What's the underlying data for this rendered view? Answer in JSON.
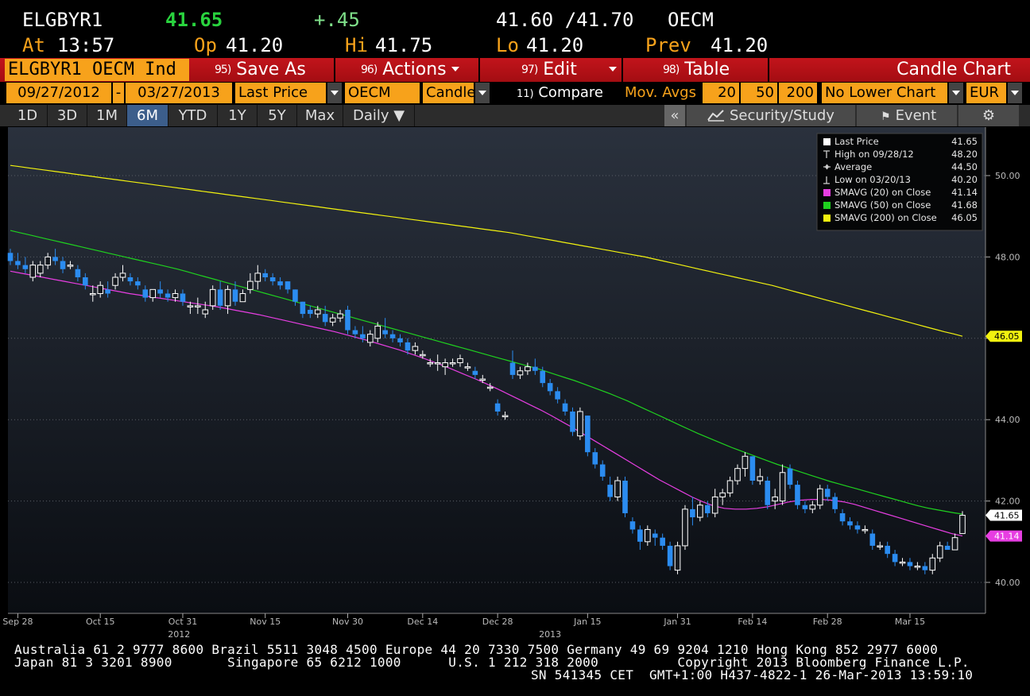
{
  "header": {
    "ticker": "ELGBYR1",
    "last": "41.65",
    "change": "+.45",
    "bid_ask": "41.60 /41.70",
    "source": "OECM",
    "at_label": "At",
    "at_time": "13:57",
    "open_label": "Op",
    "open": "41.20",
    "high_label": "Hi",
    "high": "41.75",
    "low_label": "Lo",
    "low": "41.20",
    "prev_label": "Prev",
    "prev": "41.20"
  },
  "toolbar": {
    "security": "ELGBYR1 OECM Ind",
    "save_num": "95)",
    "save_label": "Save As",
    "actions_num": "96)",
    "actions_label": "Actions",
    "edit_num": "97)",
    "edit_label": "Edit",
    "table_num": "98)",
    "table_label": "Table",
    "chart_type_title": "Candle Chart"
  },
  "options": {
    "start_date": "09/27/2012",
    "dash": "-",
    "end_date": "03/27/2013",
    "field": "Last Price",
    "source": "OECM",
    "style": "Candle",
    "compare_num": "11)",
    "compare": "Compare",
    "mov_avgs": "Mov. Avgs",
    "ma1": "20",
    "ma2": "50",
    "ma3": "200",
    "lower_chart": "No Lower Chart",
    "currency": "EUR"
  },
  "ranges": {
    "items": [
      "1D",
      "3D",
      "1M",
      "6M",
      "YTD",
      "1Y",
      "5Y",
      "Max"
    ],
    "selected": "6M",
    "frequency": "Daily",
    "collapse": "«",
    "security_study": "Security/Study",
    "event": "Event"
  },
  "chart_data": {
    "type": "candlestick",
    "y_ticks": [
      "50.00",
      "48.00",
      "46.00",
      "44.00",
      "42.00",
      "40.00"
    ],
    "ylim": [
      39.5,
      51.2
    ],
    "x_ticks": [
      "Sep 28",
      "Oct 15",
      "Oct 31",
      "Nov 15",
      "Nov 30",
      "Dec 14",
      "Dec 28",
      "Jan 15",
      "Jan 31",
      "Feb 14",
      "Feb 28",
      "Mar 15"
    ],
    "year_labels": [
      "2012",
      "2013"
    ],
    "legend": [
      {
        "icon": "box",
        "label": "Last Price",
        "value": "41.65"
      },
      {
        "icon": "high",
        "label": "High on 09/28/12",
        "value": "48.20"
      },
      {
        "icon": "avg",
        "label": "Average",
        "value": "44.50"
      },
      {
        "icon": "low",
        "label": "Low on 03/20/13",
        "value": "40.20"
      },
      {
        "icon": "#e73ee2",
        "label": "SMAVG (20) on Close",
        "value": "41.14"
      },
      {
        "icon": "#1fd11f",
        "label": "SMAVG (50) on Close",
        "value": "41.68"
      },
      {
        "icon": "#f2f20f",
        "label": "SMAVG (200) on Close",
        "value": "46.05"
      }
    ],
    "price_tags": [
      {
        "value": "46.05",
        "color": "#f2f20f"
      },
      {
        "value": "41.65",
        "color": "#ffffff"
      },
      {
        "value": "41.14",
        "color": "#e73ee2"
      }
    ],
    "candles": [
      [
        48.1,
        48.2,
        47.8,
        47.9
      ],
      [
        47.9,
        48.1,
        47.7,
        47.8
      ],
      [
        47.8,
        48.0,
        47.6,
        47.7
      ],
      [
        47.5,
        47.9,
        47.4,
        47.8
      ],
      [
        47.6,
        47.9,
        47.5,
        47.8
      ],
      [
        47.8,
        48.1,
        47.7,
        48.0
      ],
      [
        48.0,
        48.2,
        47.8,
        47.9
      ],
      [
        47.9,
        48.0,
        47.6,
        47.7
      ],
      [
        47.8,
        47.9,
        47.7,
        47.8
      ],
      [
        47.7,
        47.8,
        47.4,
        47.5
      ],
      [
        47.5,
        47.6,
        47.2,
        47.3
      ],
      [
        47.1,
        47.3,
        46.9,
        47.1
      ],
      [
        47.1,
        47.4,
        47.0,
        47.3
      ],
      [
        47.2,
        47.4,
        47.0,
        47.1
      ],
      [
        47.3,
        47.6,
        47.2,
        47.5
      ],
      [
        47.5,
        47.8,
        47.4,
        47.6
      ],
      [
        47.5,
        47.6,
        47.3,
        47.4
      ],
      [
        47.4,
        47.5,
        47.2,
        47.3
      ],
      [
        47.2,
        47.3,
        46.9,
        47.0
      ],
      [
        47.0,
        47.2,
        46.9,
        47.2
      ],
      [
        47.2,
        47.4,
        47.0,
        47.1
      ],
      [
        47.1,
        47.2,
        46.9,
        47.0
      ],
      [
        47.0,
        47.2,
        46.9,
        47.1
      ],
      [
        47.1,
        47.2,
        46.8,
        46.9
      ],
      [
        46.8,
        46.9,
        46.6,
        46.8
      ],
      [
        46.8,
        47.0,
        46.6,
        46.8
      ],
      [
        46.6,
        46.9,
        46.5,
        46.7
      ],
      [
        46.8,
        47.3,
        46.7,
        47.2
      ],
      [
        47.2,
        47.4,
        46.7,
        46.8
      ],
      [
        46.8,
        47.3,
        46.6,
        47.2
      ],
      [
        47.2,
        47.4,
        46.8,
        46.9
      ],
      [
        46.9,
        47.2,
        46.9,
        47.1
      ],
      [
        47.2,
        47.6,
        47.1,
        47.4
      ],
      [
        47.4,
        47.8,
        47.2,
        47.6
      ],
      [
        47.6,
        47.7,
        47.4,
        47.5
      ],
      [
        47.5,
        47.6,
        47.3,
        47.4
      ],
      [
        47.4,
        47.5,
        47.2,
        47.3
      ],
      [
        47.4,
        47.4,
        47.1,
        47.2
      ],
      [
        47.2,
        47.2,
        46.8,
        46.9
      ],
      [
        46.9,
        46.9,
        46.5,
        46.6
      ],
      [
        46.7,
        46.8,
        46.5,
        46.6
      ],
      [
        46.6,
        46.8,
        46.5,
        46.7
      ],
      [
        46.6,
        46.8,
        46.3,
        46.4
      ],
      [
        46.4,
        46.6,
        46.3,
        46.5
      ],
      [
        46.5,
        46.7,
        46.4,
        46.6
      ],
      [
        46.7,
        46.8,
        46.1,
        46.2
      ],
      [
        46.2,
        46.3,
        46.0,
        46.1
      ],
      [
        46.1,
        46.3,
        45.9,
        46.0
      ],
      [
        45.9,
        46.2,
        45.8,
        46.1
      ],
      [
        46.0,
        46.4,
        45.9,
        46.3
      ],
      [
        46.2,
        46.5,
        46.0,
        46.1
      ],
      [
        46.1,
        46.2,
        45.9,
        46.0
      ],
      [
        46.0,
        46.1,
        45.8,
        45.9
      ],
      [
        45.9,
        46.0,
        45.6,
        45.7
      ],
      [
        45.7,
        45.9,
        45.6,
        45.8
      ],
      [
        45.6,
        45.7,
        45.5,
        45.6
      ],
      [
        45.4,
        45.5,
        45.3,
        45.4
      ],
      [
        45.4,
        45.6,
        45.2,
        45.4
      ],
      [
        45.3,
        45.5,
        45.1,
        45.4
      ],
      [
        45.4,
        45.5,
        45.3,
        45.4
      ],
      [
        45.4,
        45.6,
        45.3,
        45.5
      ],
      [
        45.3,
        45.4,
        45.2,
        45.3
      ],
      [
        45.2,
        45.3,
        45.0,
        45.1
      ],
      [
        45.0,
        45.1,
        44.9,
        45.0
      ],
      [
        44.8,
        44.9,
        44.7,
        44.8
      ],
      [
        44.4,
        44.5,
        44.1,
        44.2
      ],
      [
        44.1,
        44.2,
        44.0,
        44.1
      ],
      [
        45.4,
        45.7,
        45.0,
        45.1
      ],
      [
        45.1,
        45.3,
        45.0,
        45.2
      ],
      [
        45.2,
        45.4,
        45.1,
        45.3
      ],
      [
        45.3,
        45.5,
        45.1,
        45.2
      ],
      [
        45.2,
        45.3,
        44.8,
        44.9
      ],
      [
        44.9,
        45.0,
        44.6,
        44.7
      ],
      [
        44.7,
        44.8,
        44.4,
        44.5
      ],
      [
        44.4,
        44.5,
        44.1,
        44.2
      ],
      [
        44.2,
        44.3,
        43.6,
        43.7
      ],
      [
        43.6,
        44.3,
        43.5,
        44.2
      ],
      [
        44.1,
        44.1,
        43.1,
        43.2
      ],
      [
        43.2,
        43.3,
        42.8,
        42.9
      ],
      [
        42.9,
        43.0,
        42.5,
        42.6
      ],
      [
        42.4,
        42.6,
        42.0,
        42.1
      ],
      [
        42.1,
        42.6,
        42.0,
        42.5
      ],
      [
        42.5,
        42.6,
        41.6,
        41.7
      ],
      [
        41.5,
        41.6,
        41.2,
        41.3
      ],
      [
        41.3,
        41.4,
        40.8,
        41.0
      ],
      [
        41.0,
        41.4,
        40.9,
        41.3
      ],
      [
        41.2,
        41.3,
        40.9,
        41.1
      ],
      [
        41.1,
        41.2,
        40.8,
        40.9
      ],
      [
        40.9,
        41.0,
        40.3,
        40.4
      ],
      [
        40.3,
        41.0,
        40.2,
        40.9
      ],
      [
        40.9,
        41.9,
        40.8,
        41.8
      ],
      [
        41.8,
        42.1,
        41.4,
        41.6
      ],
      [
        41.6,
        42.0,
        41.5,
        41.9
      ],
      [
        41.9,
        42.0,
        41.6,
        41.7
      ],
      [
        41.7,
        42.3,
        41.6,
        42.1
      ],
      [
        42.1,
        42.3,
        41.9,
        42.2
      ],
      [
        42.2,
        42.6,
        42.1,
        42.5
      ],
      [
        42.5,
        42.9,
        42.4,
        42.8
      ],
      [
        42.8,
        43.2,
        42.6,
        43.1
      ],
      [
        43.1,
        43.1,
        42.4,
        42.5
      ],
      [
        42.5,
        42.8,
        42.4,
        42.6
      ],
      [
        42.5,
        42.6,
        41.8,
        41.9
      ],
      [
        42.0,
        42.3,
        41.8,
        42.1
      ],
      [
        42.0,
        42.9,
        41.9,
        42.7
      ],
      [
        42.8,
        42.9,
        42.3,
        42.4
      ],
      [
        42.4,
        42.5,
        41.8,
        41.9
      ],
      [
        41.9,
        42.0,
        41.7,
        41.8
      ],
      [
        41.8,
        42.0,
        41.7,
        41.9
      ],
      [
        41.9,
        42.4,
        41.8,
        42.3
      ],
      [
        42.3,
        42.4,
        42.0,
        42.1
      ],
      [
        42.1,
        42.2,
        41.7,
        41.8
      ],
      [
        41.7,
        41.8,
        41.4,
        41.5
      ],
      [
        41.5,
        41.6,
        41.3,
        41.4
      ],
      [
        41.4,
        41.5,
        41.2,
        41.3
      ],
      [
        41.3,
        41.4,
        41.2,
        41.3
      ],
      [
        41.2,
        41.3,
        40.8,
        40.9
      ],
      [
        40.9,
        41.0,
        40.8,
        40.9
      ],
      [
        40.9,
        41.0,
        40.6,
        40.7
      ],
      [
        40.7,
        40.8,
        40.4,
        40.5
      ],
      [
        40.5,
        40.6,
        40.4,
        40.5
      ],
      [
        40.5,
        40.6,
        40.3,
        40.4
      ],
      [
        40.4,
        40.5,
        40.3,
        40.4
      ],
      [
        40.4,
        40.5,
        40.2,
        40.3
      ],
      [
        40.3,
        40.7,
        40.2,
        40.6
      ],
      [
        40.6,
        41.0,
        40.5,
        40.9
      ],
      [
        40.9,
        41.0,
        40.8,
        40.8
      ],
      [
        40.8,
        41.2,
        40.8,
        41.1
      ],
      [
        41.2,
        41.75,
        41.2,
        41.65
      ]
    ],
    "sma20": [
      47.65,
      47.6,
      47.55,
      47.5,
      47.45,
      47.4,
      47.35,
      47.3,
      47.25,
      47.2,
      47.15,
      47.1,
      47.06,
      47.02,
      46.98,
      46.94,
      46.9,
      46.86,
      46.82,
      46.78,
      46.73,
      46.68,
      46.63,
      46.58,
      46.52,
      46.46,
      46.4,
      46.34,
      46.28,
      46.22,
      46.16,
      46.09,
      46.02,
      45.95,
      45.87,
      45.79,
      45.71,
      45.62,
      45.53,
      45.43,
      45.33,
      45.22,
      45.11,
      45.0,
      44.88,
      44.76,
      44.63,
      44.5,
      44.37,
      44.24,
      44.1,
      43.95,
      43.8,
      43.64,
      43.48,
      43.32,
      43.16,
      43.0,
      42.84,
      42.68,
      42.52,
      42.38,
      42.24,
      42.1,
      41.98,
      41.88,
      41.82,
      41.8,
      41.8,
      41.82,
      41.86,
      41.92,
      41.98,
      42.02,
      42.04,
      42.04,
      42.02,
      41.98,
      41.92,
      41.84,
      41.76,
      41.68,
      41.6,
      41.52,
      41.44,
      41.36,
      41.28,
      41.2,
      41.14
    ],
    "sma20_start": 0,
    "sma50": [
      48.65,
      48.6,
      48.55,
      48.5,
      48.45,
      48.4,
      48.35,
      48.3,
      48.25,
      48.2,
      48.15,
      48.1,
      48.05,
      48.0,
      47.95,
      47.9,
      47.85,
      47.8,
      47.75,
      47.7,
      47.64,
      47.58,
      47.52,
      47.46,
      47.4,
      47.34,
      47.28,
      47.22,
      47.16,
      47.1,
      47.04,
      46.98,
      46.92,
      46.86,
      46.8,
      46.74,
      46.68,
      46.62,
      46.56,
      46.5,
      46.44,
      46.38,
      46.32,
      46.26,
      46.2,
      46.14,
      46.08,
      46.02,
      45.96,
      45.9,
      45.84,
      45.78,
      45.72,
      45.66,
      45.6,
      45.54,
      45.48,
      45.42,
      45.36,
      45.3,
      45.24,
      45.17,
      45.1,
      45.03,
      44.96,
      44.88,
      44.8,
      44.72,
      44.64,
      44.55,
      44.46,
      44.36,
      44.26,
      44.16,
      44.06,
      43.96,
      43.86,
      43.76,
      43.66,
      43.57,
      43.48,
      43.39,
      43.3,
      43.22,
      43.14,
      43.06,
      42.98,
      42.9,
      42.83,
      42.76,
      42.69,
      42.62,
      42.55,
      42.48,
      42.42,
      42.36,
      42.3,
      42.24,
      42.18,
      42.12,
      42.06,
      42.0,
      41.94,
      41.88,
      41.83,
      41.79,
      41.75,
      41.71,
      41.68
    ],
    "sma50_start": 0,
    "sma200": [
      50.25,
      50.22,
      50.19,
      50.16,
      50.13,
      50.1,
      50.07,
      50.04,
      50.01,
      49.98,
      49.95,
      49.92,
      49.89,
      49.86,
      49.83,
      49.8,
      49.77,
      49.74,
      49.71,
      49.68,
      49.65,
      49.62,
      49.59,
      49.56,
      49.53,
      49.5,
      49.47,
      49.44,
      49.41,
      49.38,
      49.35,
      49.32,
      49.29,
      49.26,
      49.23,
      49.2,
      49.17,
      49.14,
      49.11,
      49.08,
      49.05,
      49.02,
      48.99,
      48.96,
      48.93,
      48.9,
      48.87,
      48.84,
      48.81,
      48.78,
      48.75,
      48.72,
      48.69,
      48.66,
      48.63,
      48.6,
      48.56,
      48.52,
      48.48,
      48.44,
      48.4,
      48.36,
      48.32,
      48.28,
      48.24,
      48.2,
      48.16,
      48.12,
      48.08,
      48.04,
      48.0,
      47.95,
      47.9,
      47.85,
      47.8,
      47.75,
      47.7,
      47.65,
      47.6,
      47.55,
      47.5,
      47.45,
      47.4,
      47.35,
      47.3,
      47.24,
      47.18,
      47.12,
      47.06,
      47.0,
      46.94,
      46.88,
      46.82,
      46.76,
      46.7,
      46.64,
      46.58,
      46.52,
      46.46,
      46.4,
      46.34,
      46.28,
      46.22,
      46.16,
      46.11,
      46.05
    ],
    "sma200_start": 0
  },
  "footer": {
    "line1": "Australia 61 2 9777 8600 Brazil 5511 3048 4500 Europe 44 20 7330 7500 Germany 49 69 9204 1210 Hong Kong 852 2977 6000",
    "line2": "Japan 81 3 3201 8900       Singapore 65 6212 1000      U.S. 1 212 318 2000          Copyright 2013 Bloomberg Finance L.P.",
    "line3": "SN 541345 CET  GMT+1:00 H437-4822-1 26-Mar-2013 13:59:10"
  }
}
